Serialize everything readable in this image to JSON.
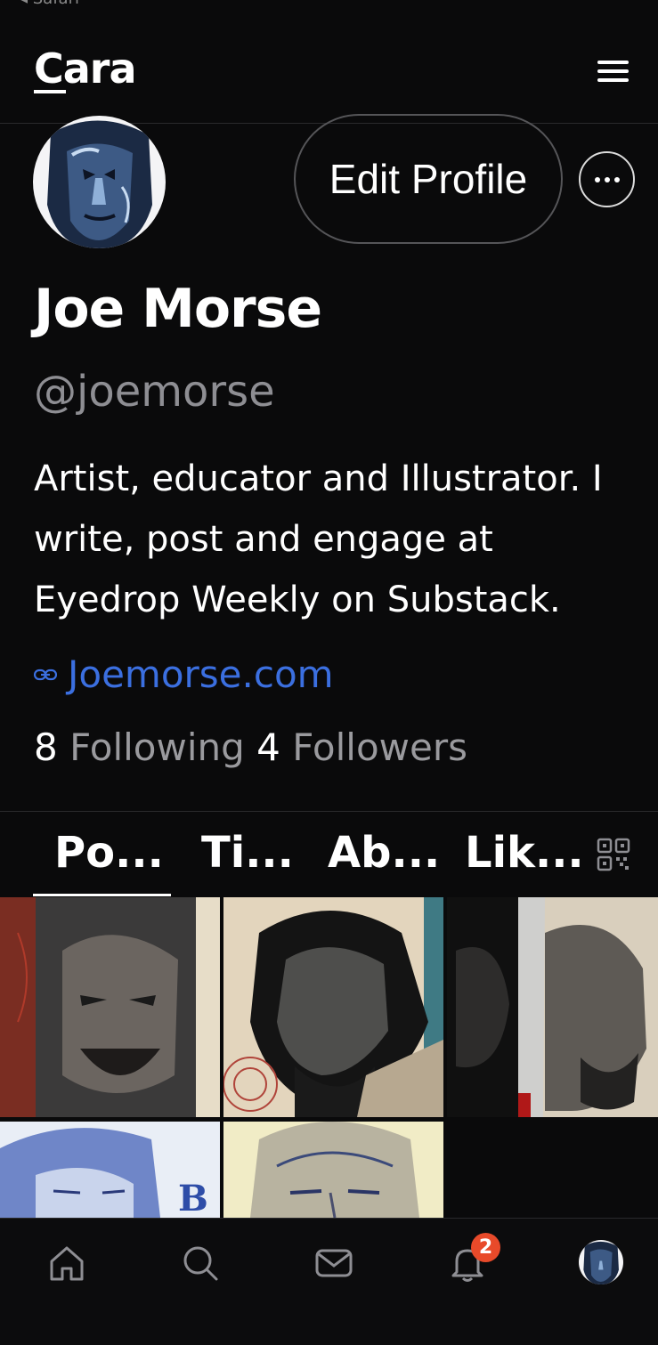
{
  "status": {
    "back_label": "◂ Safari"
  },
  "header": {
    "logo": "Cara"
  },
  "profile": {
    "edit_label": "Edit Profile",
    "name": "Joe Morse",
    "handle": "@joemorse",
    "bio": "Artist, educator and Illustrator. I write, post and engage at Eyedrop Weekly on Substack.",
    "website": "Joemorse.com",
    "following_count": "8",
    "following_label": "Following",
    "followers_count": "4",
    "followers_label": "Followers"
  },
  "tabs": [
    {
      "label": "Po...",
      "active": true
    },
    {
      "label": "Ti...",
      "active": false
    },
    {
      "label": "Ab...",
      "active": false
    },
    {
      "label": "Lik...",
      "active": false
    }
  ],
  "bottom_nav": {
    "items": [
      "home-icon",
      "search-icon",
      "mail-icon",
      "bell-icon",
      "profile-avatar"
    ],
    "notification_count": "2"
  },
  "colors": {
    "background": "#0a0a0b",
    "link": "#3b6fe0",
    "badge": "#e84a2a",
    "secondary_text": "#8e8e93"
  }
}
